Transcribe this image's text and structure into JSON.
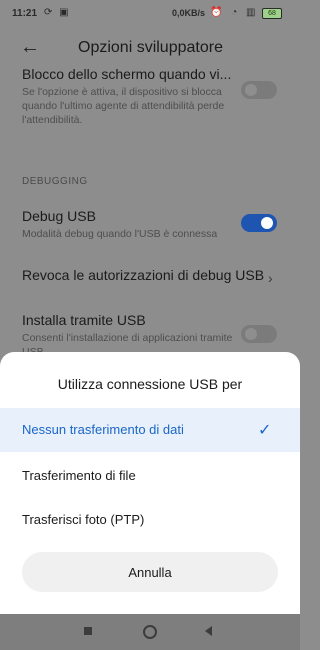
{
  "status_bar": {
    "time": "11:21",
    "left_icons": "⟳ ▣",
    "speed": "0,0KB/s",
    "right_icons": "⏰ ◔ ▥",
    "battery": "68"
  },
  "appbar": {
    "title": "Opzioni sviluppatore"
  },
  "settings": {
    "lock": {
      "title": "Blocco dello schermo quando vi...",
      "subtitle": "Se l'opzione è attiva, il dispositivo si blocca quando l'ultimo agente di attendibilità perde l'attendibilità.",
      "enabled": false
    },
    "section": "DEBUGGING",
    "debug_usb": {
      "title": "Debug USB",
      "subtitle": "Modalità debug quando l'USB è connessa",
      "enabled": true
    },
    "revoke": {
      "title": "Revoca le autorizzazioni di debug USB"
    },
    "install_usb": {
      "title": "Installa tramite USB",
      "subtitle": "Consenti l'installazione di applicazioni tramite USB",
      "enabled": false
    }
  },
  "sheet": {
    "title": "Utilizza connessione USB per",
    "options": [
      {
        "label": "Nessun trasferimento di dati",
        "selected": true
      },
      {
        "label": "Trasferimento di file",
        "selected": false
      },
      {
        "label": "Trasferisci foto (PTP)",
        "selected": false
      }
    ],
    "cancel_label": "Annulla"
  },
  "colors": {
    "accent": "#1a66c9",
    "toggle_on": "#1d55b0",
    "selected_row": "#e8f0fb"
  }
}
